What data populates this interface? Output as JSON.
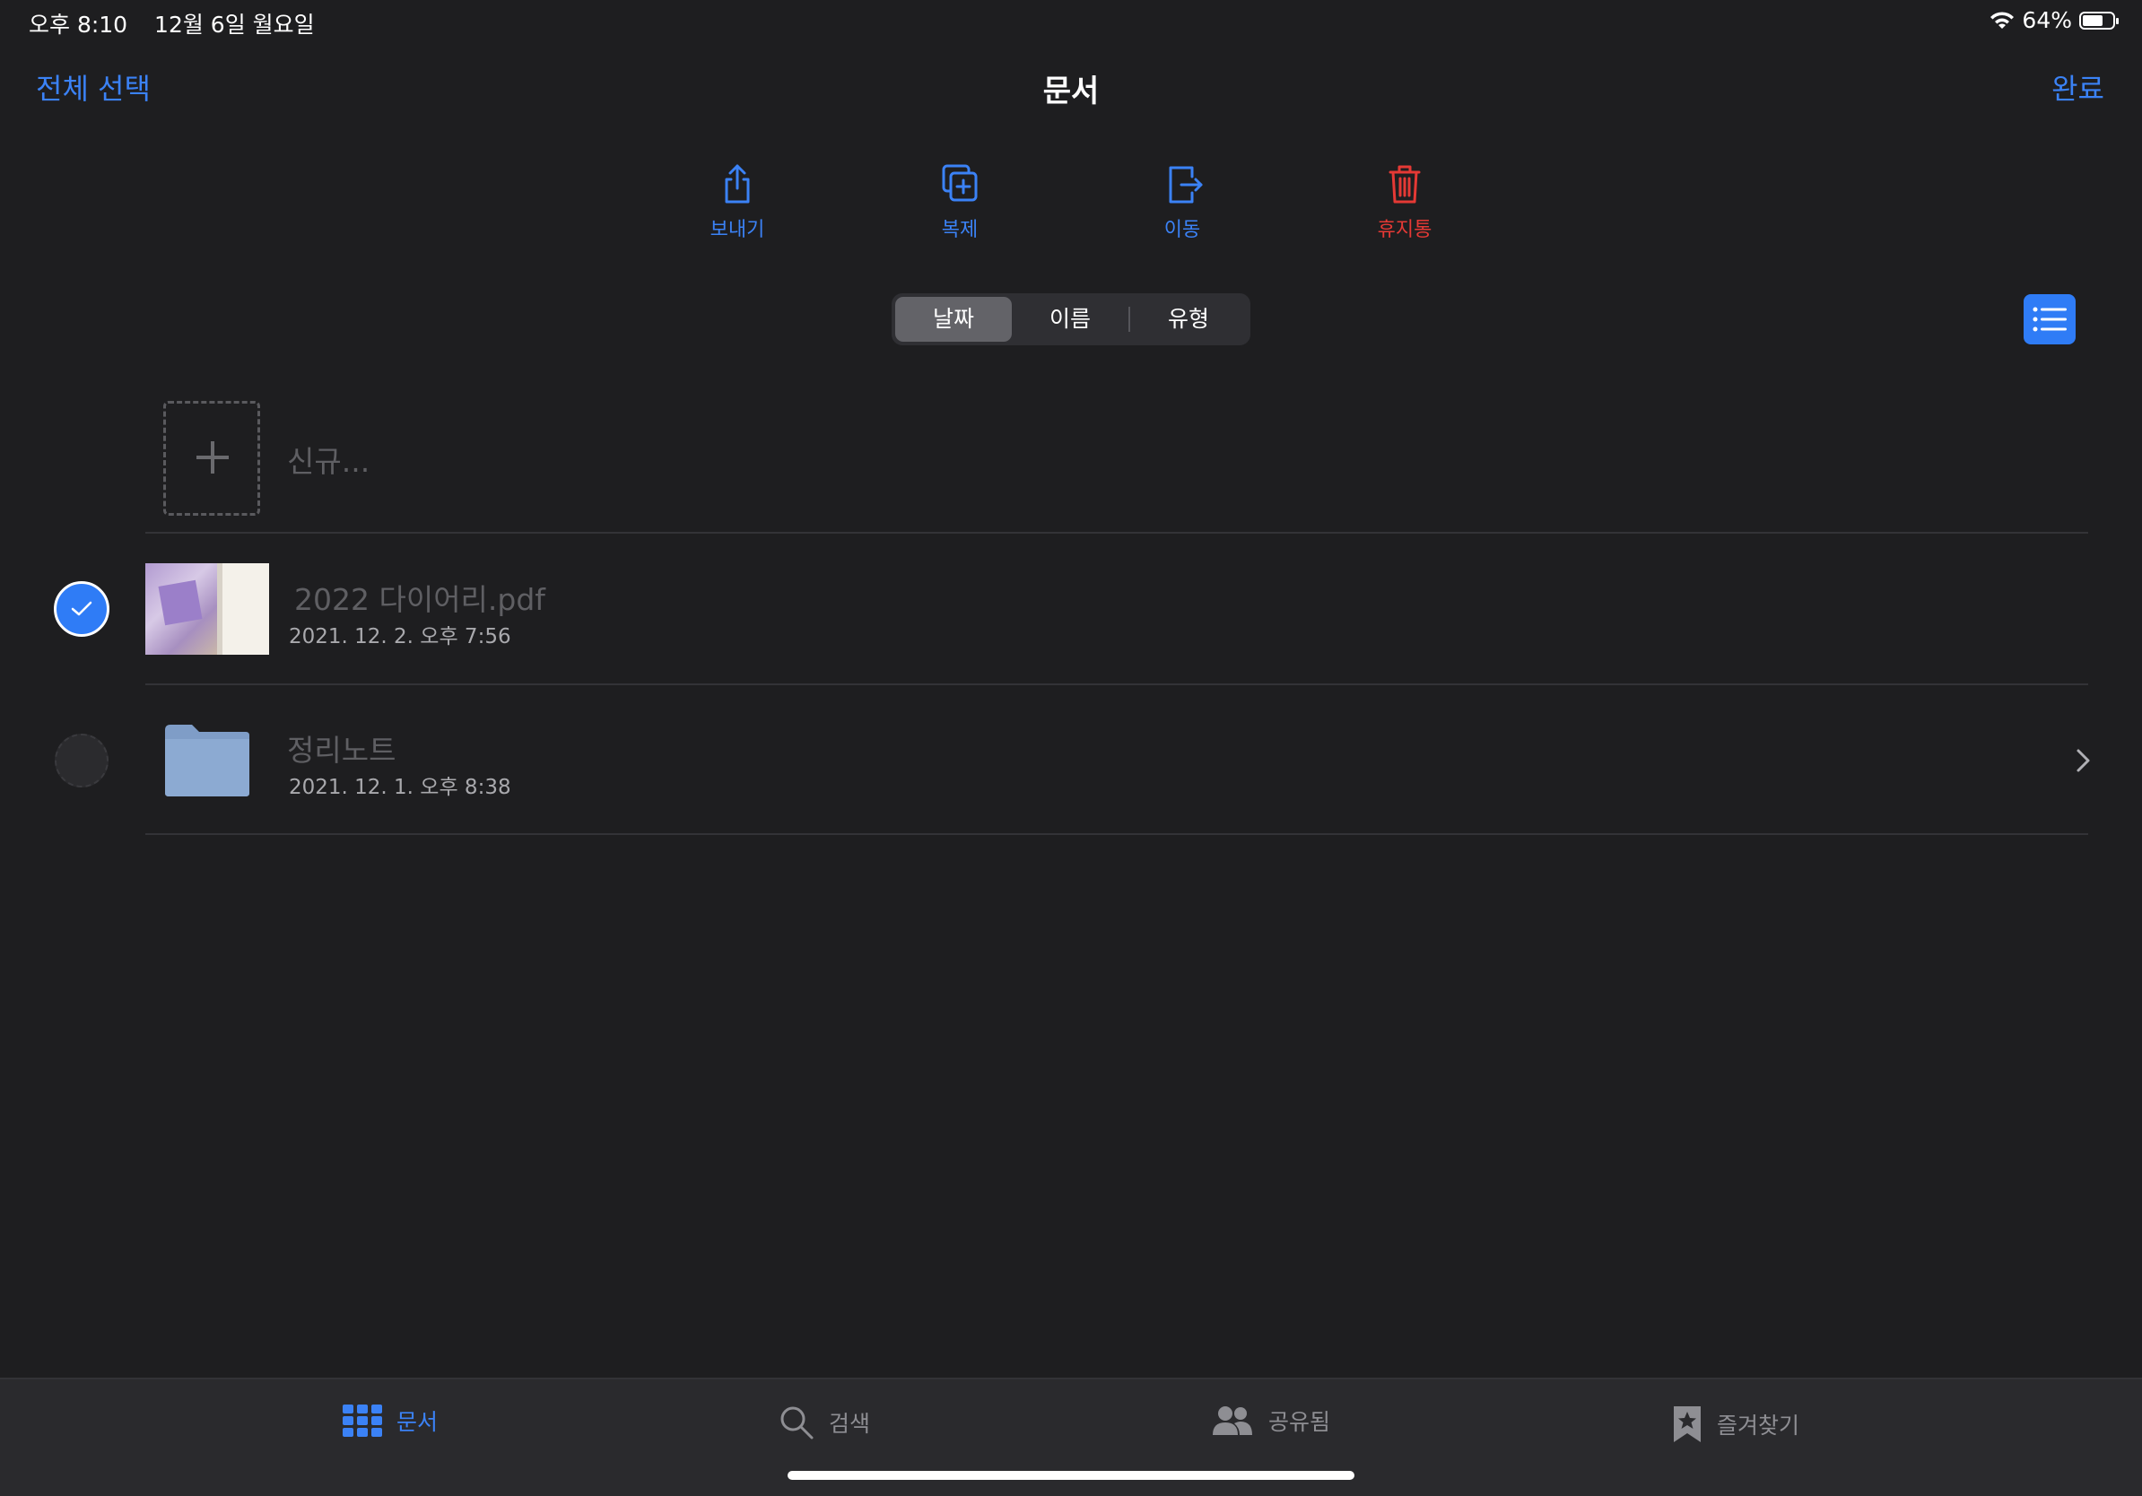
{
  "status_bar": {
    "time": "오후 8:10",
    "date": "12월 6일 월요일",
    "battery": "64%"
  },
  "nav": {
    "select_all": "전체 선택",
    "title": "문서",
    "done": "완료"
  },
  "toolbar": {
    "send": "보내기",
    "duplicate": "복제",
    "move": "이동",
    "trash": "휴지통"
  },
  "sort": {
    "options": [
      "날짜",
      "이름",
      "유형"
    ],
    "selected": "날짜"
  },
  "new_item": {
    "label": "신규..."
  },
  "items": [
    {
      "name": "2022 다이어리.pdf",
      "date": "2021. 12. 2. 오후 7:56",
      "type": "pdf",
      "selected": true
    },
    {
      "name": "정리노트",
      "date": "2021. 12. 1. 오후 8:38",
      "type": "folder",
      "selected": false
    }
  ],
  "tabbar": {
    "tabs": [
      {
        "label": "문서",
        "icon": "grid-icon",
        "active": true
      },
      {
        "label": "검색",
        "icon": "search-icon",
        "active": false
      },
      {
        "label": "공유됨",
        "icon": "people-icon",
        "active": false
      },
      {
        "label": "즐겨찾기",
        "icon": "star-bookmark-icon",
        "active": false
      }
    ]
  },
  "colors": {
    "accent": "#3b82f6",
    "danger": "#e53935",
    "background": "#1e1e20"
  }
}
